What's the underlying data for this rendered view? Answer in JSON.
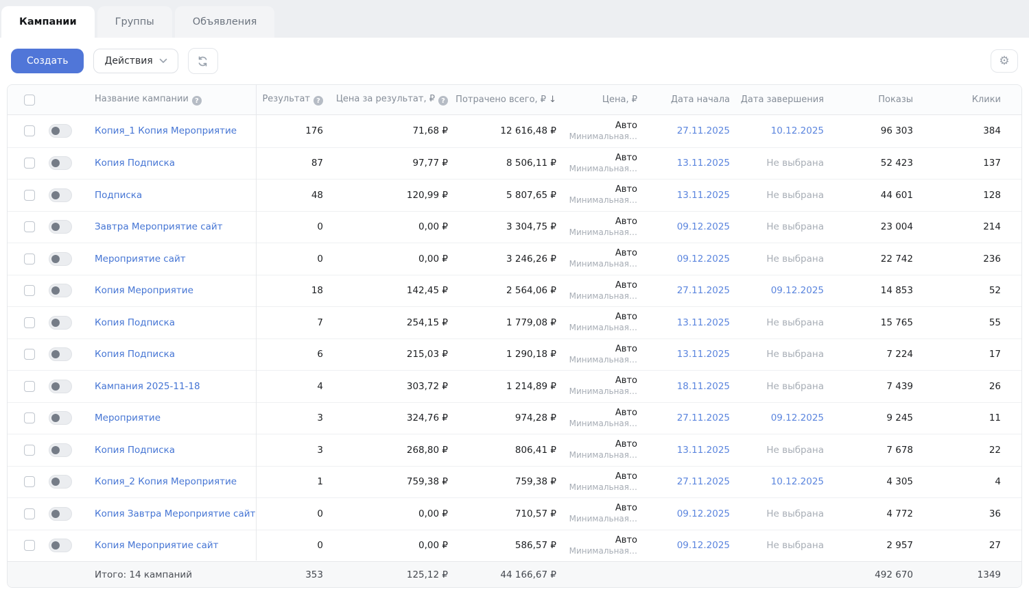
{
  "tabs": [
    {
      "id": "campaigns",
      "label": "Кампании",
      "active": true
    },
    {
      "id": "groups",
      "label": "Группы",
      "active": false
    },
    {
      "id": "ads",
      "label": "Объявления",
      "active": false
    }
  ],
  "toolbar": {
    "create_label": "Создать",
    "actions_label": "Действия"
  },
  "icons": {
    "gear": "⚙",
    "help": "?",
    "sort_desc": "↓"
  },
  "colors": {
    "accent": "#5076d8",
    "link": "#4575d4",
    "date_link": "#5b85de"
  },
  "table": {
    "headers": {
      "name": "Название кампании",
      "result": "Результат",
      "cost_per_result": "Цена за результат, ₽",
      "spent_total": "Потрачено всего, ₽",
      "price": "Цена, ₽",
      "date_start": "Дата начала",
      "date_end": "Дата завершения",
      "shows": "Показы",
      "clicks": "Клики"
    },
    "rows": [
      {
        "name": "Копия_1 Копия Мероприятие",
        "result": "176",
        "cpr": "71,68 ₽",
        "spent": "12 616,48 ₽",
        "price": "Авто",
        "price_sub": "Минимальная…",
        "start": "27.11.2025",
        "end": "10.12.2025",
        "shows": "96 303",
        "clicks": "384"
      },
      {
        "name": "Копия Подписка",
        "result": "87",
        "cpr": "97,77 ₽",
        "spent": "8 506,11 ₽",
        "price": "Авто",
        "price_sub": "Минимальная…",
        "start": "13.11.2025",
        "end": "Не выбрана",
        "shows": "52 423",
        "clicks": "137"
      },
      {
        "name": "Подписка",
        "result": "48",
        "cpr": "120,99 ₽",
        "spent": "5 807,65 ₽",
        "price": "Авто",
        "price_sub": "Минимальная…",
        "start": "13.11.2025",
        "end": "Не выбрана",
        "shows": "44 601",
        "clicks": "128"
      },
      {
        "name": "Завтра Мероприятие сайт",
        "result": "0",
        "cpr": "0,00 ₽",
        "spent": "3 304,75 ₽",
        "price": "Авто",
        "price_sub": "Минимальная…",
        "start": "09.12.2025",
        "end": "Не выбрана",
        "shows": "23 004",
        "clicks": "214"
      },
      {
        "name": "Мероприятие сайт",
        "result": "0",
        "cpr": "0,00 ₽",
        "spent": "3 246,26 ₽",
        "price": "Авто",
        "price_sub": "Минимальная…",
        "start": "09.12.2025",
        "end": "Не выбрана",
        "shows": "22 742",
        "clicks": "236"
      },
      {
        "name": "Копия Мероприятие",
        "result": "18",
        "cpr": "142,45 ₽",
        "spent": "2 564,06 ₽",
        "price": "Авто",
        "price_sub": "Минимальная…",
        "start": "27.11.2025",
        "end": "09.12.2025",
        "shows": "14 853",
        "clicks": "52"
      },
      {
        "name": "Копия Подписка",
        "result": "7",
        "cpr": "254,15 ₽",
        "spent": "1 779,08 ₽",
        "price": "Авто",
        "price_sub": "Минимальная…",
        "start": "13.11.2025",
        "end": "Не выбрана",
        "shows": "15 765",
        "clicks": "55"
      },
      {
        "name": "Копия Подписка",
        "result": "6",
        "cpr": "215,03 ₽",
        "spent": "1 290,18 ₽",
        "price": "Авто",
        "price_sub": "Минимальная…",
        "start": "13.11.2025",
        "end": "Не выбрана",
        "shows": "7 224",
        "clicks": "17"
      },
      {
        "name": "Кампания 2025-11-18",
        "result": "4",
        "cpr": "303,72 ₽",
        "spent": "1 214,89 ₽",
        "price": "Авто",
        "price_sub": "Минимальная…",
        "start": "18.11.2025",
        "end": "Не выбрана",
        "shows": "7 439",
        "clicks": "26"
      },
      {
        "name": "Мероприятие",
        "result": "3",
        "cpr": "324,76 ₽",
        "spent": "974,28 ₽",
        "price": "Авто",
        "price_sub": "Минимальная…",
        "start": "27.11.2025",
        "end": "09.12.2025",
        "shows": "9 245",
        "clicks": "11"
      },
      {
        "name": "Копия Подписка",
        "result": "3",
        "cpr": "268,80 ₽",
        "spent": "806,41 ₽",
        "price": "Авто",
        "price_sub": "Минимальная…",
        "start": "13.11.2025",
        "end": "Не выбрана",
        "shows": "7 678",
        "clicks": "22"
      },
      {
        "name": "Копия_2 Копия Мероприятие",
        "result": "1",
        "cpr": "759,38 ₽",
        "spent": "759,38 ₽",
        "price": "Авто",
        "price_sub": "Минимальная…",
        "start": "27.11.2025",
        "end": "10.12.2025",
        "shows": "4 305",
        "clicks": "4"
      },
      {
        "name": "Копия Завтра Мероприятие сайт",
        "result": "0",
        "cpr": "0,00 ₽",
        "spent": "710,57 ₽",
        "price": "Авто",
        "price_sub": "Минимальная…",
        "start": "09.12.2025",
        "end": "Не выбрана",
        "shows": "4 772",
        "clicks": "36"
      },
      {
        "name": "Копия Мероприятие сайт",
        "result": "0",
        "cpr": "0,00 ₽",
        "spent": "586,57 ₽",
        "price": "Авто",
        "price_sub": "Минимальная…",
        "start": "09.12.2025",
        "end": "Не выбрана",
        "shows": "2 957",
        "clicks": "27"
      }
    ],
    "footer": {
      "label": "Итого: 14 кампаний",
      "result": "353",
      "cpr": "125,12 ₽",
      "spent": "44 166,67 ₽",
      "shows": "492 670",
      "clicks": "1349"
    },
    "no_end_date_text": "Не выбрана"
  }
}
